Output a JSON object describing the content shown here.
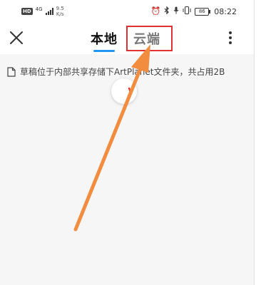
{
  "status_bar": {
    "badge": "HD",
    "network": "4G",
    "speed_value": "9.5",
    "speed_unit": "K/s",
    "battery": "86",
    "time": "08:22",
    "icons": [
      "alarm-icon",
      "bluetooth-icon",
      "mic-icon",
      "vibrate-icon",
      "battery-icon"
    ]
  },
  "header": {
    "close_icon": "close-icon",
    "tabs": [
      {
        "label": "本地",
        "active": true
      },
      {
        "label": "云端",
        "active": false
      }
    ],
    "more_icon": "more-vert-icon"
  },
  "content": {
    "info_icon": "document-icon",
    "info_text": "草稿位于内部共享存储下ArtPlanet文件夹，共占用2B",
    "loading": "spinner"
  },
  "colors": {
    "accent": "#2196F3",
    "highlight": "#e03131",
    "arrow": "#f28c3e",
    "spinner": "#e53935",
    "background": "#f6f6f6"
  }
}
